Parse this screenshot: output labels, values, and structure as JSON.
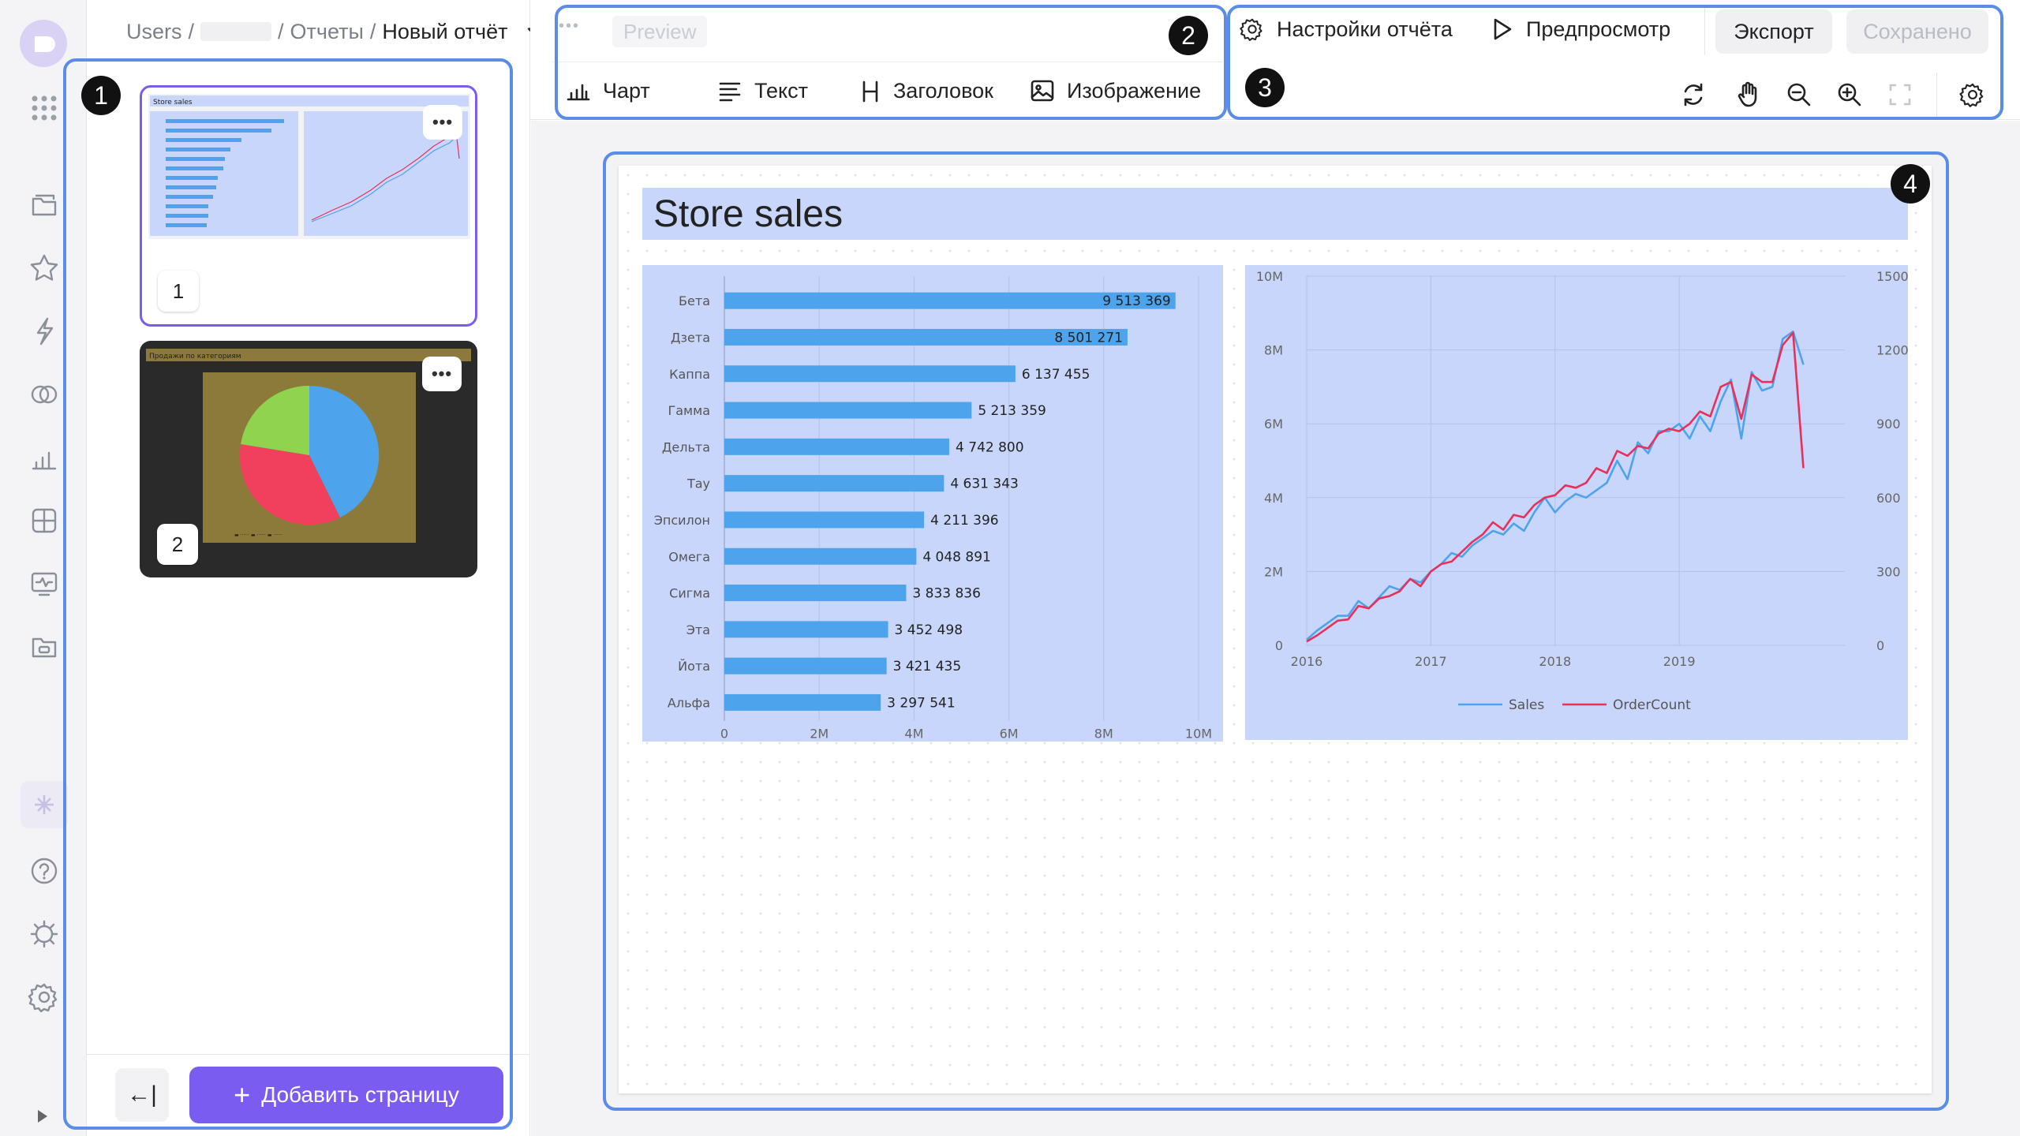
{
  "breadcrumb": {
    "root": "Users",
    "sep1": "/",
    "sep2": "/",
    "section": "Отчеты",
    "sep3": "/",
    "current": "Новый отчёт"
  },
  "toolbar": {
    "more": "•••",
    "preview_tab": "Preview",
    "insert": [
      "Чарт",
      "Текст",
      "Заголовок",
      "Изображение"
    ],
    "report_settings": "Настройки отчёта",
    "preview": "Предпросмотр",
    "export": "Экспорт",
    "saved": "Сохранено"
  },
  "sidebar": {
    "pages": [
      {
        "number": "1",
        "title": "Store sales"
      },
      {
        "number": "2",
        "title": "Продажи по категориям"
      }
    ],
    "page_menu": "•••",
    "add_page": "Добавить страницу",
    "collapse": "←|"
  },
  "callouts": [
    "1",
    "2",
    "3",
    "4"
  ],
  "report": {
    "title": "Store sales"
  },
  "colors": {
    "accent": "#7b5cf0",
    "callout": "#5a8de8",
    "bar": "#4da3ec",
    "sales": "#4da3ec",
    "orders": "#e8305a",
    "panel": "#c9d6fb"
  },
  "chart_data": [
    {
      "type": "bar",
      "orientation": "horizontal",
      "categories": [
        "Бета",
        "Дзета",
        "Каппа",
        "Гамма",
        "Дельта",
        "Тау",
        "Эпсилон",
        "Омега",
        "Сигма",
        "Эта",
        "Йота",
        "Альфа"
      ],
      "values": [
        9513369,
        8501271,
        6137455,
        5213359,
        4742800,
        4631343,
        4211396,
        4048891,
        3833836,
        3452498,
        3421435,
        3297541
      ],
      "labels": [
        "9 513 369",
        "8 501 271",
        "6 137 455",
        "5 213 359",
        "4 742 800",
        "4 631 343",
        "4 211 396",
        "4 048 891",
        "3 833 836",
        "3 452 498",
        "3 421 435",
        "3 297 541"
      ],
      "xticks": [
        "0",
        "2M",
        "4M",
        "6M",
        "8M",
        "10M"
      ],
      "xlim": [
        0,
        10000000
      ]
    },
    {
      "type": "line",
      "xticks": [
        "2016",
        "2017",
        "2018",
        "2019"
      ],
      "yticks_left": [
        "0",
        "2M",
        "4M",
        "6M",
        "8M",
        "10M"
      ],
      "yticks_right": [
        "0",
        "300",
        "600",
        "900",
        "1200",
        "1500"
      ],
      "ylim_left": [
        0,
        10000000
      ],
      "ylim_right": [
        0,
        1500
      ],
      "x_start": "2016-01",
      "series": [
        {
          "name": "Sales",
          "axis": "left",
          "values": [
            0.15,
            0.4,
            0.6,
            0.8,
            0.8,
            1.2,
            1.0,
            1.3,
            1.6,
            1.5,
            1.8,
            1.7,
            2.0,
            2.2,
            2.5,
            2.4,
            2.7,
            2.9,
            3.1,
            3.0,
            3.3,
            3.1,
            3.6,
            4.0,
            3.6,
            3.9,
            4.1,
            4.0,
            4.2,
            4.4,
            5.0,
            4.5,
            5.5,
            5.2,
            5.8,
            5.8,
            6.0,
            5.6,
            6.2,
            5.8,
            6.6,
            7.2,
            5.6,
            7.4,
            6.9,
            7.0,
            8.3,
            8.5,
            7.6
          ]
        },
        {
          "name": "OrderCount",
          "axis": "right",
          "values": [
            15,
            40,
            70,
            100,
            105,
            160,
            150,
            190,
            200,
            220,
            270,
            240,
            300,
            330,
            340,
            380,
            420,
            450,
            500,
            470,
            530,
            520,
            570,
            600,
            610,
            650,
            640,
            660,
            720,
            700,
            790,
            770,
            810,
            800,
            860,
            880,
            870,
            900,
            950,
            930,
            1050,
            1070,
            920,
            1100,
            1070,
            1070,
            1220,
            1270,
            720
          ]
        }
      ],
      "legend": "bottom"
    }
  ]
}
